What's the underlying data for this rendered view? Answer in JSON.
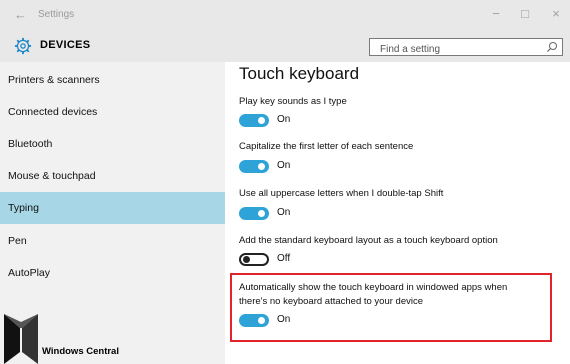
{
  "window": {
    "title": "Settings",
    "back_glyph": "←",
    "minimize_glyph": "−",
    "maximize_glyph": "□",
    "close_glyph": "×"
  },
  "header": {
    "icon": "gear-icon",
    "section_title": "DEVICES",
    "search_placeholder": "Find a setting",
    "search_icon": "search-icon"
  },
  "sidebar": {
    "items": [
      {
        "label": "Printers & scanners",
        "selected": false
      },
      {
        "label": "Connected devices",
        "selected": false
      },
      {
        "label": "Bluetooth",
        "selected": false
      },
      {
        "label": "Mouse & touchpad",
        "selected": false
      },
      {
        "label": "Typing",
        "selected": true
      },
      {
        "label": "Pen",
        "selected": false
      },
      {
        "label": "AutoPlay",
        "selected": false
      }
    ],
    "brand": "Windows Central"
  },
  "main": {
    "title": "Touch keyboard",
    "settings": [
      {
        "label": "Play key sounds as I type",
        "state": "On",
        "on": true
      },
      {
        "label": "Capitalize the first letter of each sentence",
        "state": "On",
        "on": true
      },
      {
        "label": "Use all uppercase letters when I double-tap Shift",
        "state": "On",
        "on": true
      },
      {
        "label": "Add the standard keyboard layout as a touch keyboard option",
        "state": "Off",
        "on": false
      },
      {
        "label_line1": "Automatically show the touch keyboard in windowed apps when",
        "label_line2": "there's no keyboard attached to your device",
        "state": "On",
        "on": true
      }
    ]
  },
  "colors": {
    "accent": "#2ea3d8",
    "selected_nav": "#a7d7e6",
    "highlight_box": "#e2232a",
    "sidebar_bg": "#f1f1f1",
    "header_bg": "#e8e8e8"
  }
}
